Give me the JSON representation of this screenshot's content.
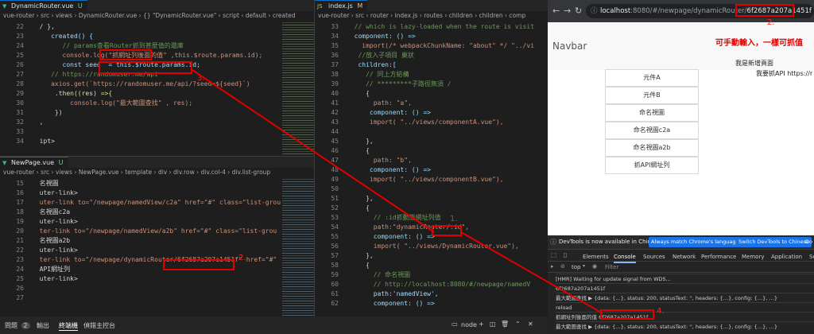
{
  "left_top": {
    "tab": "DynamicRouter.vue",
    "tab_flag": "U",
    "breadcrumb": "vue-router › src › views › DynamicRouter.vue › {} \"DynamicRouter.vue\" › script › default › created",
    "lines": [
      {
        "n": "22",
        "t": "  / },"
      },
      {
        "n": "23",
        "t": "     created() {"
      },
      {
        "n": "24",
        "t": "        // params查看Router抓到甚麼值的還庫"
      },
      {
        "n": "25",
        "t": "        console.log(\"抓網址列後面的值\" ,this.$route.params.id);"
      },
      {
        "n": "26",
        "t": "        const seed  = this.$route.params.id;"
      },
      {
        "n": "27",
        "t": "     // https://randomuser.me/api"
      },
      {
        "n": "28",
        "t": "     axios.get(`https://randomuser.me/api/?seed=${seed}`)"
      },
      {
        "n": "29",
        "t": "      .then((res) =>{"
      },
      {
        "n": "30",
        "t": "          console.log(\"最大範圍查找\" , res);"
      },
      {
        "n": "31",
        "t": "      })"
      },
      {
        "n": "32",
        "t": "  ,"
      },
      {
        "n": "33",
        "t": ""
      },
      {
        "n": "34",
        "t": "  ipt>"
      }
    ]
  },
  "left_bottom": {
    "tab": "NewPage.vue",
    "tab_flag": "U",
    "breadcrumb": "vue-router › src › views › NewPage.vue › template › div › div.row › div.col-4 › div.list-group",
    "lines": [
      {
        "n": "15",
        "t": "  名視圖"
      },
      {
        "n": "16",
        "t": "  uter-link>"
      },
      {
        "n": "17",
        "t": "  uter-link to=\"/newpage/namedView/c2a\" href=\"#\" class=\"list-grou"
      },
      {
        "n": "18",
        "t": "  名視圖c2a"
      },
      {
        "n": "19",
        "t": "  uter-link>"
      },
      {
        "n": "20",
        "t": "  ter-link to=\"/newpage/namedView/a2b\" href=\"#\" class=\"list-grou"
      },
      {
        "n": "21",
        "t": "  名視圖a2b"
      },
      {
        "n": "22",
        "t": "  uter-link>"
      },
      {
        "n": "23",
        "t": "  ter-link to=\"/newpage/dynamicRouter/6f2687a207a1451f\" href=\"#\""
      },
      {
        "n": "24",
        "t": "  API網址列"
      },
      {
        "n": "25",
        "t": "  uter-link>"
      },
      {
        "n": "26",
        "t": ""
      },
      {
        "n": "27",
        "t": ""
      }
    ]
  },
  "middle": {
    "tab": "index.js",
    "tab_flag": "M",
    "breadcrumb": "vue-router › src › router › index.js › routes › children › children › comp",
    "lines": [
      {
        "n": "33",
        "t": "  // which is lazy-loaded when the route is visit"
      },
      {
        "n": "34",
        "t": "  component: () =>"
      },
      {
        "n": "35",
        "t": "    import(/* webpackChunkName: \"about\" */ \"../vi"
      },
      {
        "n": "36",
        "t": "   //放入子項目 巢狀"
      },
      {
        "n": "37",
        "t": "   children:["
      },
      {
        "n": "38",
        "t": "     // 同上方結構"
      },
      {
        "n": "39",
        "t": "     // *********子路徑無須 /"
      },
      {
        "n": "40",
        "t": "     {"
      },
      {
        "n": "41",
        "t": "       path: \"a\","
      },
      {
        "n": "42",
        "t": "      component: () =>"
      },
      {
        "n": "43",
        "t": "      import( \"../views/componentA.vue\"),"
      },
      {
        "n": "44",
        "t": ""
      },
      {
        "n": "45",
        "t": "     },"
      },
      {
        "n": "46",
        "t": "     {"
      },
      {
        "n": "47",
        "t": "       path: \"b\","
      },
      {
        "n": "48",
        "t": "      component: () =>"
      },
      {
        "n": "49",
        "t": "      import( \"../views/componentB.vue\"),"
      },
      {
        "n": "50",
        "t": ""
      },
      {
        "n": "51",
        "t": "     },"
      },
      {
        "n": "52",
        "t": "     {"
      },
      {
        "n": "53",
        "t": "       // :id抓動態網址列值"
      },
      {
        "n": "54",
        "t": "       path:\"dynamicRouter/:id\","
      },
      {
        "n": "55",
        "t": "       component: () =>"
      },
      {
        "n": "56",
        "t": "       import( \"../views/DynamicRouter.vue\"),"
      },
      {
        "n": "57",
        "t": "     },"
      },
      {
        "n": "58",
        "t": "     {"
      },
      {
        "n": "59",
        "t": "       // 命名視圖"
      },
      {
        "n": "60",
        "t": "       // http://localhost:8080/#/newpage/namedV"
      },
      {
        "n": "61",
        "t": "       path:'namedView',"
      },
      {
        "n": "62",
        "t": "       component: () =>"
      }
    ]
  },
  "browser": {
    "url_host": "localhost",
    "url_rest": ":8080/#/newpage/dynamicRouter/",
    "url_id": "6f2687a207a1451f",
    "navbar": "Navbar",
    "note": "可手動輸入，一樣可抓值",
    "new_page_text": "我是新增頁面",
    "api_text": "我要抓API https://r",
    "list": [
      "元件A",
      "元件B",
      "命名視圖",
      "命名視圖c2a",
      "命名視圖a2b",
      "抓API網址列"
    ],
    "devtools_banner": "DevTools is now available in Chinese!",
    "banner_btn1": "Always match Chrome's language",
    "banner_btn2": "Switch DevTools to Chinese",
    "banner_btn3": "Do",
    "dev_tabs": [
      "Elements",
      "Console",
      "Sources",
      "Network",
      "Performance",
      "Memory",
      "Application",
      "Se"
    ],
    "console_context": "top",
    "filter_placeholder": "Filter",
    "logs": [
      "[HMR] Waiting for update signal from WDS...",
      "6f2687a207a1451f",
      "最大範圍查找 ▶ {data: {…}, status: 200, statusText: '', headers: {…}, config: {…}, …}",
      "reload",
      "抓網址列後面的值  6f2687a207a1451f",
      "最大範圍查找 ▶ {data: {…}, status: 200, statusText: '', headers: {…}, config: {…}, …}"
    ]
  },
  "annotations": {
    "n1": "1.",
    "n2a": "2.",
    "n2b": "2.",
    "n3": "3.",
    "n4": "4."
  },
  "statusbar": {
    "problems_label": "問題",
    "problems_count": "2",
    "output": "輸出",
    "terminal": "終端機",
    "debug_console": "偵錯主控台",
    "shell": "node"
  },
  "colors": {
    "annotation": "#e00000",
    "accent": "#0e70c0"
  }
}
